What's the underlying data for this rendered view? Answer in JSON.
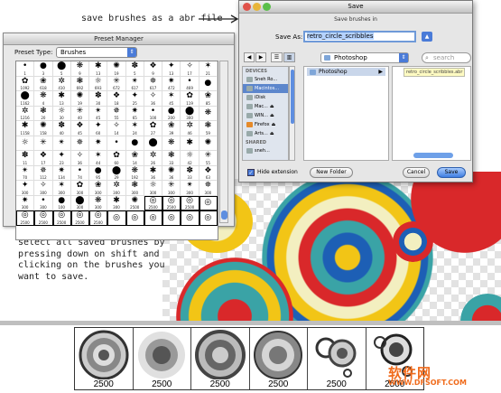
{
  "annotations": {
    "top": "save brushes as a abr file",
    "bottom": "select all saved brushes by pressing down on shift and clicking on the brushes you want to save."
  },
  "preset_manager": {
    "title": "Preset Manager",
    "type_label": "Preset Type:",
    "type_value": "Brushes",
    "brush_sizes": [
      "1",
      "3",
      "5",
      "9",
      "13",
      "19",
      "5",
      "9",
      "13",
      "17",
      "21",
      "1092",
      "618",
      "410",
      "692",
      "693",
      "672",
      "617",
      "617",
      "472",
      "469",
      "",
      "1162",
      "4",
      "13",
      "19",
      "30",
      "18",
      "25",
      "36",
      "45",
      "119",
      "85",
      "1216",
      "20",
      "30",
      "40",
      "45",
      "55",
      "65",
      "100",
      "200",
      "300",
      "",
      "1158",
      "158",
      "40",
      "45",
      "60",
      "14",
      "24",
      "27",
      "39",
      "46",
      "59",
      "",
      "",
      "",
      "",
      "",
      "",
      "",
      "",
      "",
      "",
      "",
      "11",
      "17",
      "23",
      "36",
      "44",
      "60",
      "14",
      "26",
      "33",
      "42",
      "55",
      "70",
      "112",
      "134",
      "74",
      "95",
      "29",
      "192",
      "36",
      "36",
      "33",
      "63",
      "300",
      "300",
      "300",
      "300",
      "300",
      "300",
      "300",
      "300",
      "300",
      "300",
      "300",
      "300",
      "300",
      "100",
      "300",
      "300",
      "300",
      "2500",
      "2500",
      "2500",
      "2500",
      "",
      "2500",
      "2500",
      "2500",
      "2500",
      "2500",
      "",
      "",
      "",
      "",
      "",
      ""
    ]
  },
  "save_dialog": {
    "title": "Save",
    "subtitle": "Save brushes in",
    "save_as_label": "Save As:",
    "filename": "retro_circle_scribbles",
    "folder": "Photoshop",
    "search_placeholder": "search",
    "devices_header": "DEVICES",
    "devices": [
      "Sneh Ro...",
      "Macintos...",
      "iDisk",
      "Mac...",
      "WIN...",
      "Firefox",
      "Arts..."
    ],
    "shared_header": "SHARED",
    "shared": [
      "sneh..."
    ],
    "column_item": "Photoshop",
    "file_tooltip": "retro_circle_scribbles.abr",
    "hide_extension": "Hide extension",
    "new_folder": "New Folder",
    "cancel": "Cancel",
    "save": "Save"
  },
  "saved_brushes": [
    "2500",
    "2500",
    "2500",
    "2500",
    "2500",
    "2500"
  ],
  "watermark": {
    "line1": "软件网",
    "line2": "WWW.DFSOFT.COM"
  },
  "colors": {
    "red": "#d9282a",
    "yellow": "#f2c516",
    "blue": "#1d5fb5",
    "teal": "#3aa3a6",
    "cream": "#f3efc0",
    "accent": "#4a7bd8"
  }
}
